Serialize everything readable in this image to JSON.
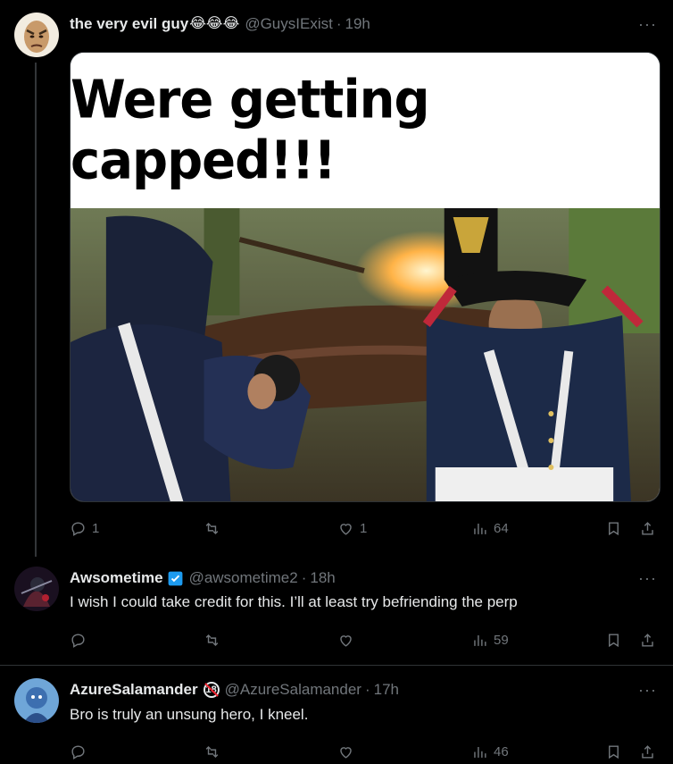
{
  "posts": [
    {
      "name": "the very evil guy",
      "name_emoji": "😂😂😂",
      "handle": "@GuysIExist",
      "time": "19h",
      "more": "···",
      "media_caption": "Were getting capped!!!",
      "actions": {
        "replies": "1",
        "reposts": "",
        "likes": "1",
        "views": "64"
      }
    },
    {
      "name": "Awsometime",
      "handle": "@awsometime2",
      "time": "18h",
      "more": "···",
      "text": "I wish I could take credit for this. I’ll at least try befriending the perp",
      "actions": {
        "replies": "",
        "reposts": "",
        "likes": "",
        "views": "59"
      }
    },
    {
      "name": "AzureSalamander",
      "age_badge": "18",
      "handle": "@AzureSalamander",
      "time": "17h",
      "more": "···",
      "text": "Bro is truly an unsung hero, I kneel.",
      "actions": {
        "replies": "",
        "reposts": "",
        "likes": "",
        "views": "46"
      }
    }
  ],
  "colors": {
    "background": "#000000",
    "text": "#e7e9ea",
    "muted": "#71767b",
    "verified_blue": "#1d9bf0",
    "divider": "#2f3336"
  },
  "icons": [
    "reply-icon",
    "repost-icon",
    "like-icon",
    "views-icon",
    "bookmark-icon",
    "share-icon",
    "verified-icon"
  ]
}
